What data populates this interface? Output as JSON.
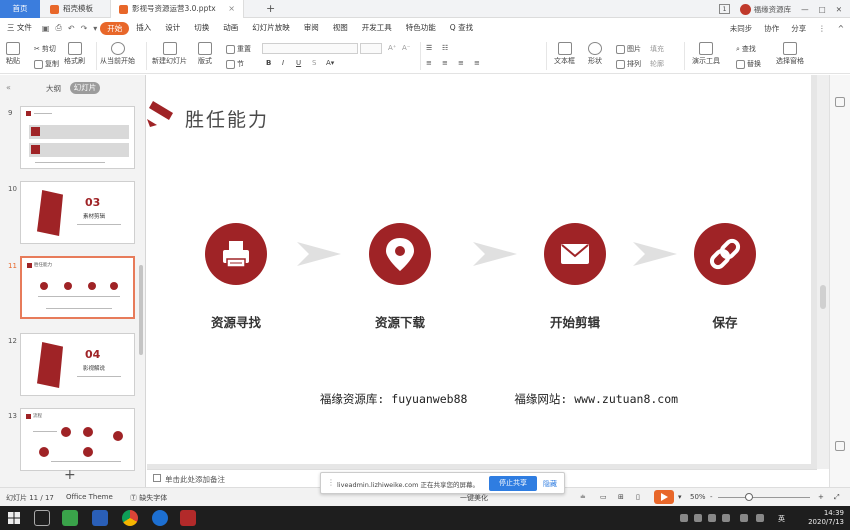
{
  "tabs": {
    "home": "首页",
    "templates": "稻壳模板",
    "file": "影视号资源运营3.0.pptx",
    "add": "+"
  },
  "window_right": {
    "count": "1",
    "user": "福缘资源库"
  },
  "menu": {
    "file": "三 文件",
    "items": [
      "开始",
      "插入",
      "设计",
      "切换",
      "动画",
      "幻灯片放映",
      "审阅",
      "视图",
      "开发工具",
      "特色功能"
    ],
    "active": "开始",
    "search": "Q 查找",
    "right": [
      "未同步",
      "协作",
      "分享"
    ]
  },
  "ribbon": {
    "paste": "粘贴",
    "cut": "剪切",
    "copy": "复制",
    "format_painter": "格式刷",
    "from_current": "从当前开始",
    "new_slide": "新建幻灯片",
    "layout": "版式",
    "section": "节",
    "reset": "重置",
    "textbox": "文本框",
    "shape": "形状",
    "picture": "图片",
    "arrange": "排列",
    "fill": "填充",
    "outline": "轮廓",
    "present": "演示工具",
    "find": "查找",
    "replace": "替换",
    "select_pane": "选择窗格"
  },
  "panel": {
    "collapse": "«",
    "outline": "大纲",
    "slides": "幻灯片",
    "add": "+",
    "thumbnails": [
      {
        "num": "9",
        "title": "资源寻找"
      },
      {
        "num": "10",
        "big": "03",
        "sub": "素材剪辑"
      },
      {
        "num": "11",
        "title": "胜任能力"
      },
      {
        "num": "12",
        "big": "04",
        "sub": "影视解说"
      },
      {
        "num": "13",
        "title": "流程"
      }
    ]
  },
  "slide": {
    "title": "胜任能力",
    "steps": [
      {
        "label": "资源寻找",
        "icon": "printer-icon"
      },
      {
        "label": "资源下载",
        "icon": "location-pin-icon"
      },
      {
        "label": "开始剪辑",
        "icon": "mail-icon"
      },
      {
        "label": "保存",
        "icon": "link-icon"
      }
    ],
    "footer_left": "福缘资源库: fuyuanweb88",
    "footer_right": "福缘网站: www.zutuan8.com",
    "accent": "#9f2326"
  },
  "notes": {
    "placeholder": "单击此处添加备注"
  },
  "share": {
    "text": "liveadmin.lizhiweike.com 正在共享您的屏幕。",
    "stop": "停止共享",
    "hide": "隐藏"
  },
  "status": {
    "slide_pos": "幻灯片 11 / 17",
    "theme": "Office Theme",
    "font_missing": "缺失字体",
    "beautify": "一键美化",
    "zoom": "50%",
    "minus": "-",
    "plus": "+"
  },
  "taskbar": {
    "time": "14:39",
    "date": "2020/7/13",
    "ime": "英"
  }
}
